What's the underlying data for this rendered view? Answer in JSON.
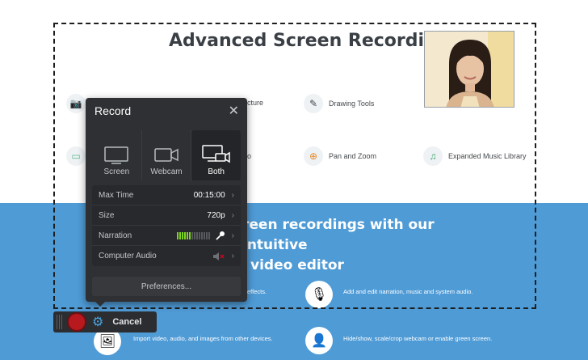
{
  "page": {
    "headline": "Advanced Screen Recording Tools",
    "features": [
      {
        "icon": "camera-icon",
        "label": ""
      },
      {
        "icon": "picture-icon",
        "label": "cture"
      },
      {
        "icon": "pencil-icon",
        "label": "Drawing Tools"
      },
      {
        "icon": "chat-icon",
        "label": ""
      },
      {
        "icon": "video-icon",
        "label": "o"
      },
      {
        "icon": "zoom-icon",
        "label": "Pan and Zoom"
      },
      {
        "icon": "music-icon",
        "label": "Expanded Music Library"
      }
    ],
    "subheadline_line1": "reen recordings with our intuitive",
    "subheadline_line2": "video editor",
    "bottom_features": [
      {
        "icon": "effects-icon",
        "label": "effects."
      },
      {
        "icon": "microphone-head-icon",
        "label": "Add and edit narration, music and system audio."
      },
      {
        "icon": "import-icon",
        "label": "Import video, audio, and images from other devices."
      },
      {
        "icon": "person-icon",
        "label": "Hide/show, scale/crop webcam or enable green screen."
      }
    ],
    "colors": {
      "blue_band": "#4f9bd6",
      "headline": "#3a3f45"
    }
  },
  "record_panel": {
    "title": "Record",
    "close_icon": "close-icon",
    "modes": [
      {
        "label": "Screen",
        "icon": "monitor-icon",
        "active": false
      },
      {
        "label": "Webcam",
        "icon": "webcam-icon",
        "active": false
      },
      {
        "label": "Both",
        "icon": "monitor-webcam-icon",
        "active": true
      }
    ],
    "settings": [
      {
        "label": "Max Time",
        "value": "00:15:00"
      },
      {
        "label": "Size",
        "value": "720p"
      },
      {
        "label": "Narration",
        "value": "",
        "icon": "microphone-icon",
        "level": 0.45
      },
      {
        "label": "Computer Audio",
        "value": "",
        "icon": "speaker-muted-icon"
      }
    ],
    "preferences_label": "Preferences..."
  },
  "control_bar": {
    "record_icon": "record-icon",
    "settings_icon": "gear-icon",
    "cancel_label": "Cancel",
    "colors": {
      "record": "#b8191f",
      "gear": "#4aa3e0"
    }
  }
}
